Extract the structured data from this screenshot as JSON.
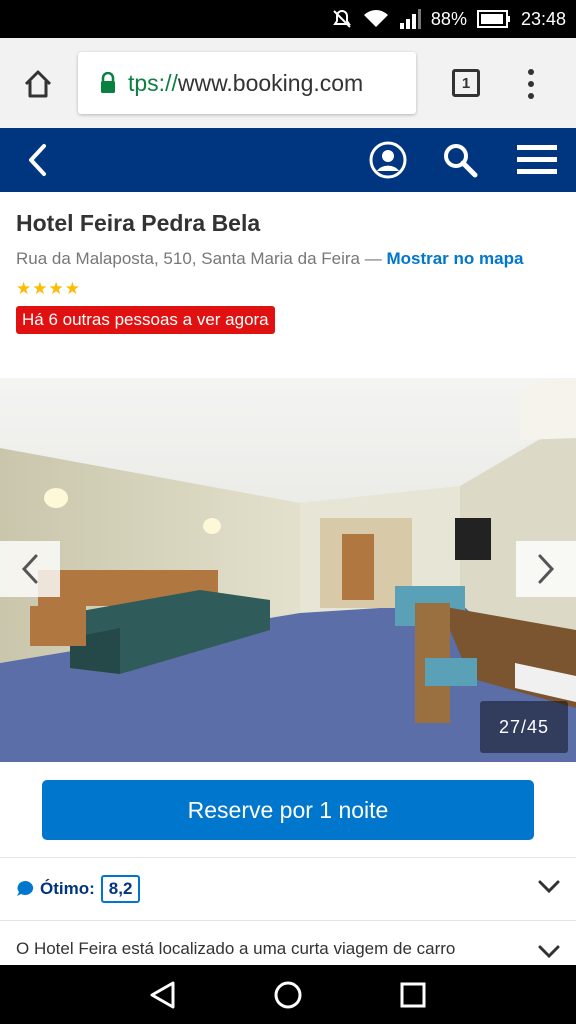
{
  "status_bar": {
    "battery_percent": "88%",
    "time": "23:48",
    "icons": [
      "mute-icon",
      "wifi-icon",
      "signal-icon",
      "battery-icon"
    ]
  },
  "browser": {
    "url_scheme": "tps://",
    "url_host": "www.booking.com",
    "tab_count": "1",
    "icons": [
      "home-icon",
      "lock-icon",
      "tabs-icon",
      "overflow-menu-icon"
    ]
  },
  "site_header": {
    "background": "#003580",
    "icons": [
      "back-icon",
      "account-icon",
      "search-icon",
      "hamburger-menu-icon"
    ]
  },
  "hotel": {
    "name": "Hotel Feira Pedra Bela",
    "address": "Rua da Malaposta, 510, Santa Maria da Feira — ",
    "map_link": "Mostrar no mapa",
    "stars": 4,
    "viewers_badge": "Há 6 outras pessoas a ver agora"
  },
  "gallery": {
    "counter": "27/45",
    "icons": [
      "chevron-left-icon",
      "chevron-right-icon"
    ]
  },
  "reserve": {
    "label": "Reserve por 1 noite",
    "color": "#0077cc"
  },
  "rating": {
    "label": "Ótimo:",
    "score": "8,2"
  },
  "description": {
    "text": "O Hotel Feira está localizado a uma curta viagem de carro"
  },
  "android_nav": {
    "icons": [
      "nav-back-icon",
      "nav-home-icon",
      "nav-recents-icon"
    ]
  },
  "colors": {
    "brand_blue": "#003580",
    "link_blue": "#0077cc",
    "badge_red": "#e21111",
    "star_yellow": "#febb02"
  }
}
